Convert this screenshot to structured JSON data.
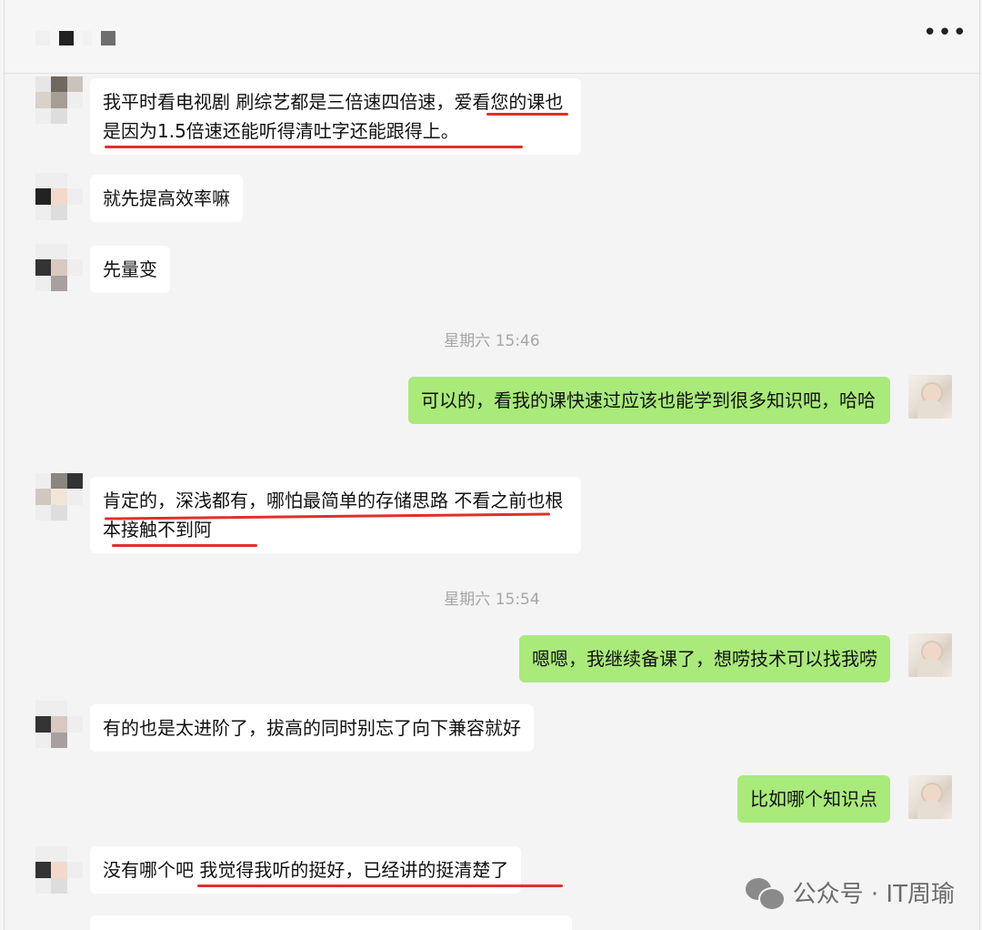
{
  "header": {
    "more_label": "•••"
  },
  "timestamps": [
    "星期六 15:46",
    "星期六 15:54"
  ],
  "messages": [
    {
      "side": "left",
      "text": "我平时看电视剧 刷综艺都是三倍速四倍速，爱看您的课也是因为1.5倍速还能听得清吐字还能跟得上。"
    },
    {
      "side": "left",
      "text": "就先提高效率嘛"
    },
    {
      "side": "left",
      "text": "先量变"
    },
    {
      "side": "right",
      "text": "可以的，看我的课快速过应该也能学到很多知识吧，哈哈"
    },
    {
      "side": "left",
      "text": "肯定的，深浅都有，哪怕最简单的存储思路  不看之前也根本接触不到阿"
    },
    {
      "side": "right",
      "text": "嗯嗯，我继续备课了，想唠技术可以找我唠"
    },
    {
      "side": "left",
      "text": "有的也是太进阶了，拔高的同时别忘了向下兼容就好"
    },
    {
      "side": "right",
      "text": "比如哪个知识点"
    },
    {
      "side": "left",
      "text": "没有哪个吧  我觉得我听的挺好，已经讲的挺清楚了"
    }
  ],
  "watermark": {
    "text": "公众号 · IT周瑜"
  },
  "colors": {
    "self_bubble": "#a9ea7a",
    "other_bubble": "#ffffff",
    "underline": "#e0302a"
  }
}
